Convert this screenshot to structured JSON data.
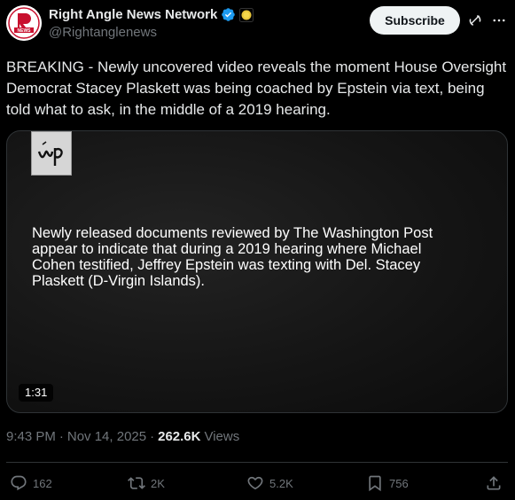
{
  "author": {
    "name": "Right Angle News Network",
    "handle": "@Rightanglenews",
    "avatar_icon": "news-logo-icon",
    "verified_color": "#1d9bf0"
  },
  "header": {
    "subscribe_label": "Subscribe"
  },
  "tweet": {
    "text": "BREAKING - Newly uncovered video reveals the moment House Oversight Democrat Stacey Plaskett was being coached by Epstein via text, being told what to ask, in the middle of a 2019 hearing."
  },
  "media": {
    "logo_icon": "washington-post-logo-icon",
    "caption": "Newly released documents reviewed by The Washington Post appear to indicate that during a 2019 hearing where Michael Cohen testified, Jeffrey Epstein was texting with Del. Stacey Plaskett (D-Virgin Islands).",
    "duration": "1:31"
  },
  "meta": {
    "time": "9:43 PM",
    "date": "Nov 14, 2025",
    "views_count": "262.6K",
    "views_label": "Views",
    "separator": "·"
  },
  "actions": {
    "replies": "162",
    "reposts": "2K",
    "likes": "5.2K",
    "bookmarks": "756"
  },
  "colors": {
    "background": "#000000",
    "text_primary": "#e7e9ea",
    "text_secondary": "#71767b",
    "border": "#2f3336"
  }
}
